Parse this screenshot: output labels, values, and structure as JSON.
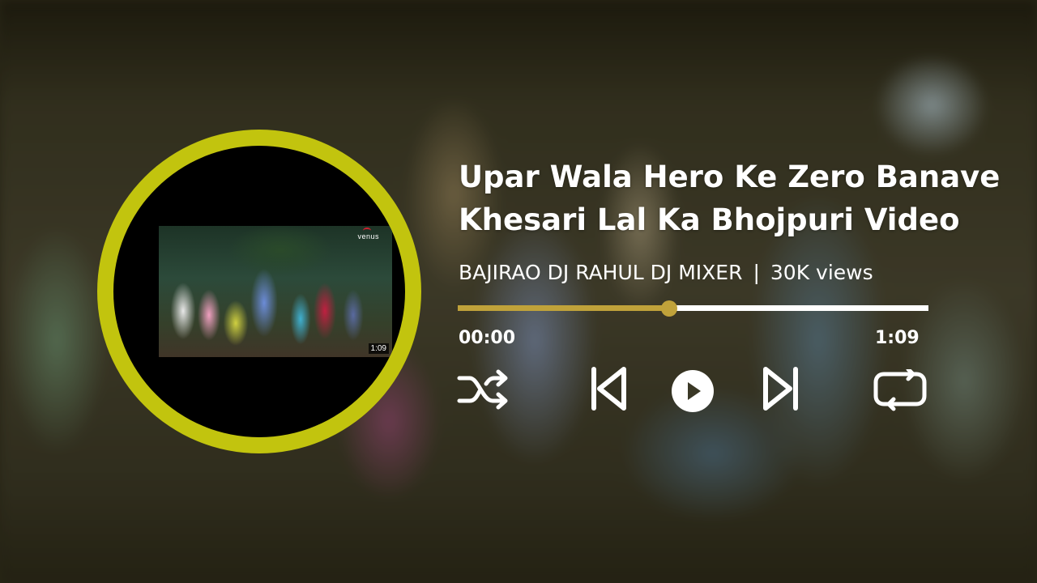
{
  "video": {
    "title_line1": "Upar Wala Hero Ke Zero Banave",
    "title_line2": "Khesari Lal Ka Bhojpuri Video",
    "channel": "BAJIRAO DJ RAHUL DJ MIXER",
    "separator": "|",
    "views": "30K views",
    "thumbnail_logo": "venus",
    "thumbnail_duration": "1:09"
  },
  "player": {
    "current_time": "00:00",
    "total_time": "1:09",
    "progress_fraction": 0.45,
    "accent_color": "#c0a23a",
    "disc_ring_color": "#c2c40e"
  },
  "controls": [
    {
      "name": "shuffle-icon"
    },
    {
      "name": "previous-icon"
    },
    {
      "name": "play-icon"
    },
    {
      "name": "next-icon"
    },
    {
      "name": "repeat-icon"
    }
  ]
}
